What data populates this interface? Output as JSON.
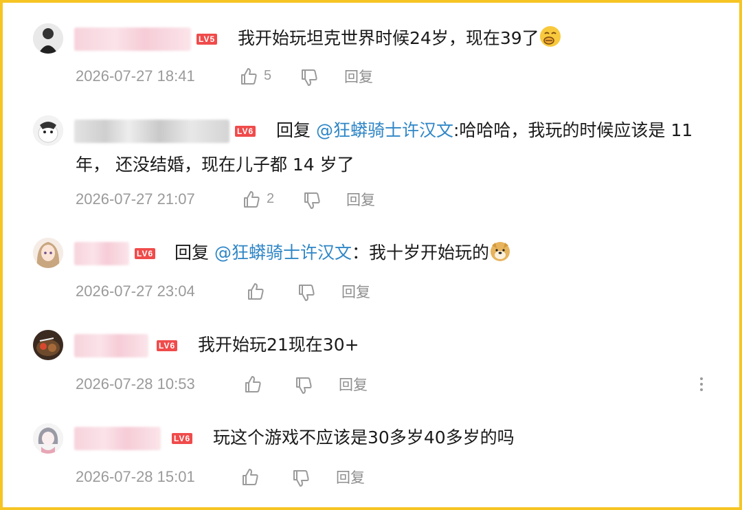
{
  "comments": [
    {
      "level": "LV5",
      "text": "我开始玩坦克世界时候24岁，现在39了",
      "emoji": "laugh-cover-mouth-emoji",
      "time": "2026-07-27 18:41",
      "likes": "5",
      "reply_label": "回复"
    },
    {
      "level": "LV6",
      "reply_prefix": "回复 ",
      "mention": "@狂蟒骑士许汉文",
      "text_line1": ":哈哈哈，我玩的时候应该是 11",
      "text_line2": "年， 还没结婚，现在儿子都 14 岁了",
      "time": "2026-07-27 21:07",
      "likes": "2",
      "reply_label": "回复"
    },
    {
      "level": "LV6",
      "reply_prefix": "回复 ",
      "mention": "@狂蟒骑士许汉文",
      "text": "：我十岁开始玩的",
      "emoji": "doge-emoji",
      "time": "2026-07-27 23:04",
      "reply_label": "回复"
    },
    {
      "level": "LV6",
      "text": "我开始玩21现在30+",
      "time": "2026-07-28 10:53",
      "reply_label": "回复"
    },
    {
      "level": "LV6",
      "text": "玩这个游戏不应该是30多岁40多岁的吗",
      "time": "2026-07-28 15:01",
      "reply_label": "回复"
    }
  ],
  "colors": {
    "border": "#f6c523",
    "level_badge": "#f04b4b",
    "mention": "#2f86c6",
    "meta_text": "#9a9a9a"
  }
}
